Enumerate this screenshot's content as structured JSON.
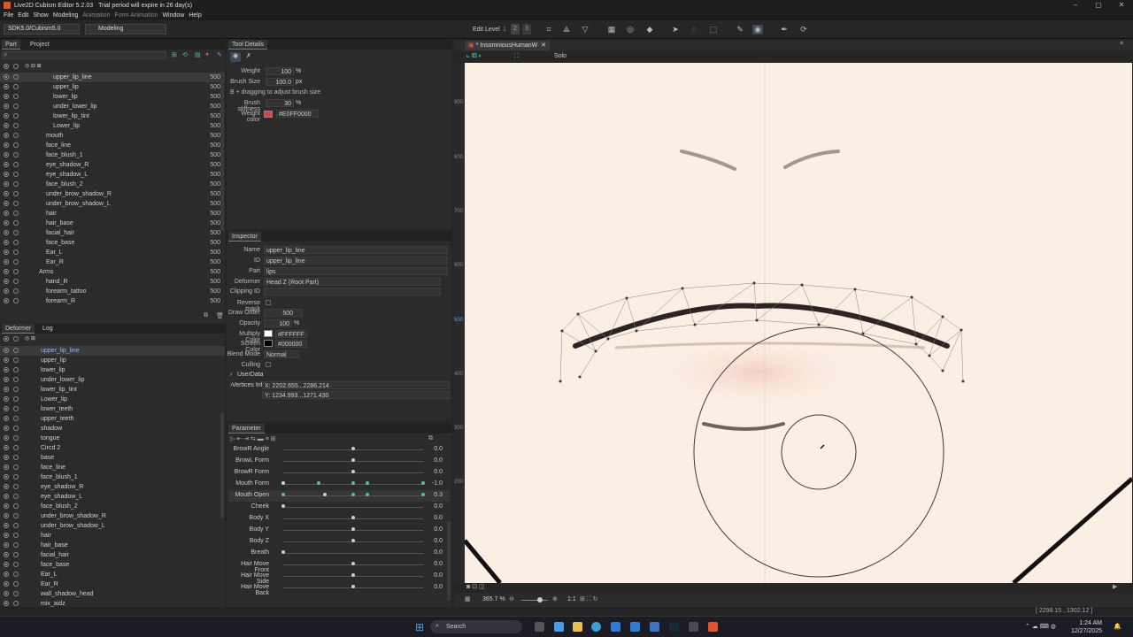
{
  "titlebar": {
    "app": "Live2D Cubism Editor 5.2.03",
    "trial": "Trial period will expire in 26 day(s)"
  },
  "menu": [
    "File",
    "Edit",
    "Show",
    "Modeling",
    "Animation",
    "Form Animation",
    "Window",
    "Help"
  ],
  "toolbar": {
    "sdk": "SDK5.0/Cubism5.0",
    "mode": "Modeling",
    "edit_level_label": "Edit Level",
    "levels": [
      "1",
      "2",
      "3"
    ]
  },
  "part_panel": {
    "tabs": [
      "Part",
      "Project"
    ],
    "rows": [
      {
        "name": "upper_lip_line",
        "val": "500"
      },
      {
        "name": "upper_lip",
        "val": "500"
      },
      {
        "name": "lower_lip",
        "val": "500"
      },
      {
        "name": "under_lower_lip",
        "val": "500"
      },
      {
        "name": "lower_lip_tint",
        "val": "500"
      },
      {
        "name": "Lower_lip",
        "val": "500"
      },
      {
        "name": "mouth",
        "val": "500"
      },
      {
        "name": "face_line",
        "val": "500"
      },
      {
        "name": "face_blush_1",
        "val": "500"
      },
      {
        "name": "eye_shadow_R",
        "val": "500"
      },
      {
        "name": "eye_shadow_L",
        "val": "500"
      },
      {
        "name": "face_blush_2",
        "val": "500"
      },
      {
        "name": "under_brow_shadow_R",
        "val": "500"
      },
      {
        "name": "under_brow_shadow_L",
        "val": "500"
      },
      {
        "name": "hair",
        "val": "500"
      },
      {
        "name": "hair_base",
        "val": "500"
      },
      {
        "name": "facial_hair",
        "val": "500"
      },
      {
        "name": "face_base",
        "val": "500"
      },
      {
        "name": "Ear_L",
        "val": "500"
      },
      {
        "name": "Ear_R",
        "val": "500"
      },
      {
        "name": "Arms",
        "val": "500"
      },
      {
        "name": "hand_R",
        "val": "500"
      },
      {
        "name": "forearm_tattoo",
        "val": "500"
      },
      {
        "name": "forearm_R",
        "val": "500"
      }
    ]
  },
  "deformer_panel": {
    "tabs": [
      "Deformer",
      "Log"
    ],
    "rows": [
      "upper_lip_line",
      "upper_lip",
      "lower_lip",
      "under_lower_lip",
      "lower_lip_tint",
      "Lower_lip",
      "lower_teeth",
      "upper_teeth",
      "shadow",
      "tongue",
      "Circd 2",
      "base",
      "face_line",
      "face_blush_1",
      "eye_shadow_R",
      "eye_shadow_L",
      "face_blush_2",
      "under_brow_shadow_R",
      "under_brow_shadow_L",
      "hair",
      "hair_base",
      "facial_hair",
      "face_base",
      "Ear_L",
      "Ear_R",
      "wall_shadow_head",
      "mix_aidz"
    ]
  },
  "tool_details": {
    "title": "Tool Details",
    "weight_label": "Weight",
    "weight": "100",
    "pct": "%",
    "brush_size_label": "Brush Size",
    "brush_size": "100.0",
    "px": "px",
    "hint": "B + dragging to adjust brush size",
    "stiffness_label": "Brush stiffness",
    "stiffness": "30",
    "color_label": "Weight color",
    "color": "#E0FF0000"
  },
  "inspector": {
    "title": "Inspector",
    "name_label": "Name",
    "name": "upper_lip_line",
    "id_label": "ID",
    "id": "upper_lip_line",
    "part_label": "Part",
    "part": "lips",
    "deformer_label": "Deformer",
    "deformer": "Head Z (Root Part)",
    "clipping_label": "Clipping ID",
    "reverse_label": "Reverse mask",
    "draw_order_label": "Draw Order",
    "draw_order": "500",
    "opacity_label": "Opacity",
    "opacity": "100",
    "pct": "%",
    "multiply_label": "Multiply Color",
    "multiply": "#FFFFFF",
    "screen_label": "Screen Color",
    "screen": "#000000",
    "blend_label": "Blend Mode",
    "blend": "Normal",
    "culling_label": "Culling",
    "userdata_label": "UserData",
    "vertices_label": "Vertices Info",
    "vx": "X: 2202.655...2286.214",
    "vy": "Y: 1234.993...1271.430"
  },
  "parameter": {
    "title": "Parameter",
    "rows": [
      {
        "name": "BrowR Angle",
        "value": "0.0",
        "level": 0.5
      },
      {
        "name": "BrowL Form",
        "value": "0.0",
        "level": 0.5
      },
      {
        "name": "BrowR Form",
        "value": "0.0",
        "level": 0.5
      },
      {
        "name": "Mouth Form",
        "value": "-1.0",
        "level": 0.0
      },
      {
        "name": "Mouth Open",
        "value": "0.3",
        "level": 0.3
      },
      {
        "name": "Cheek",
        "value": "0.0",
        "level": 0.0
      },
      {
        "name": "Body X",
        "value": "0.0",
        "level": 0.5
      },
      {
        "name": "Body Y",
        "value": "0.0",
        "level": 0.5
      },
      {
        "name": "Body Z",
        "value": "0.0",
        "level": 0.5
      },
      {
        "name": "Breath",
        "value": "0.0",
        "level": 0.0
      },
      {
        "name": "Hair Move Front",
        "value": "0.0",
        "level": 0.5
      },
      {
        "name": "Hair Move Side",
        "value": "0.0",
        "level": 0.5
      },
      {
        "name": "Hair Move Back",
        "value": "0.0",
        "level": 0.5
      }
    ]
  },
  "viewport": {
    "tab": "InsomniousHumanW",
    "solo": "Solo",
    "zoom": "365.7 %",
    "ruler": [
      "900",
      "800",
      "700",
      "600",
      "500",
      "400",
      "300",
      "200"
    ],
    "coords": "[ 2298.15 , 1302.12 ]",
    "zoom_ratio": "1:1"
  },
  "taskbar": {
    "search": "Search",
    "time": "1:24 AM",
    "date": "12/27/2025"
  },
  "colors": {
    "accent": "#4fc3a1",
    "weight": "#E0FF0000"
  }
}
